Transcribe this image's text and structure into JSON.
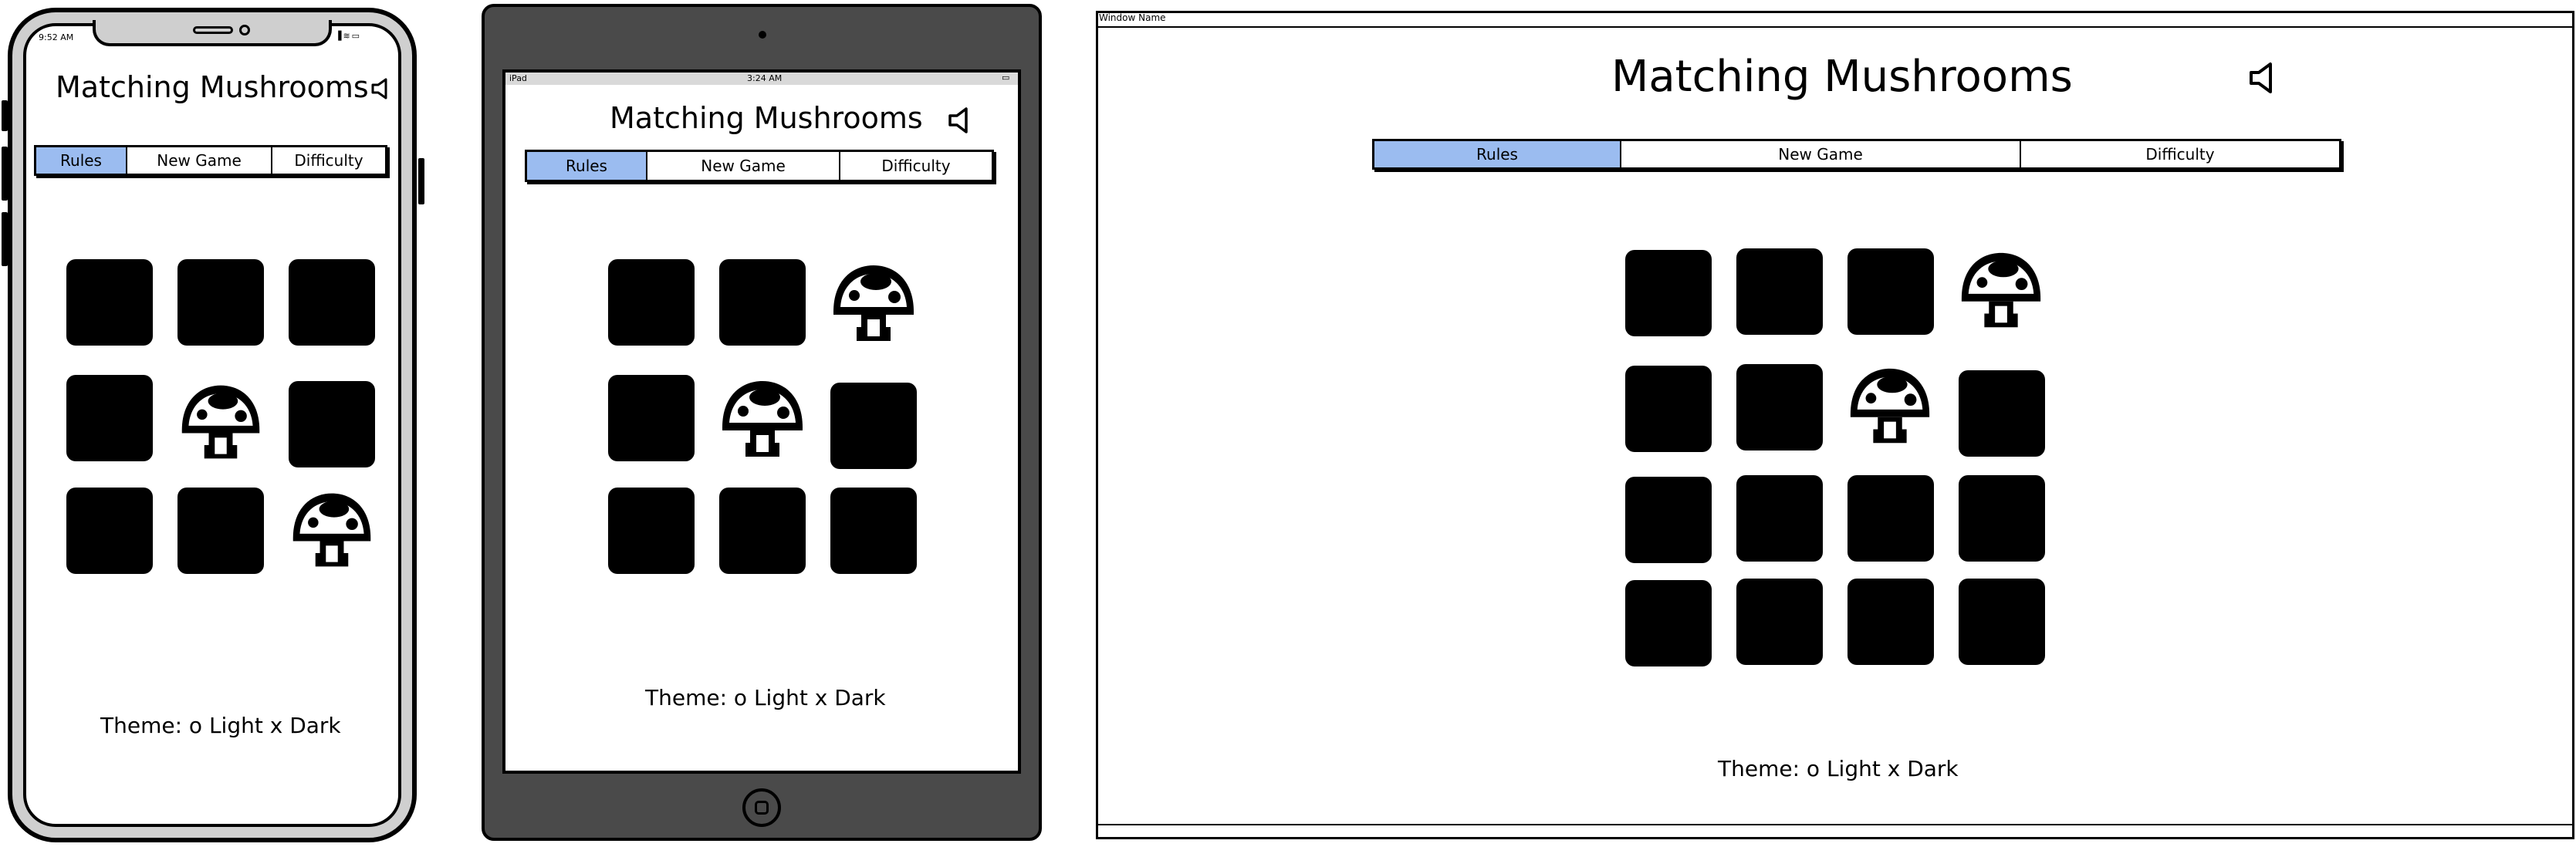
{
  "app_title": "Matching Mushrooms",
  "tabs": {
    "rules": "Rules",
    "new_game": "New Game",
    "difficulty": "Difficulty"
  },
  "theme_text": "Theme: o Light x Dark",
  "phone": {
    "status_time": "9:52 AM"
  },
  "tablet": {
    "status_device": "iPad",
    "status_time": "3:24 AM"
  },
  "desktop": {
    "window_name": "Window Name"
  },
  "colors": {
    "active_tab": "#9bbcf0",
    "tile": "#000000",
    "tablet_bezel": "#4a4a4a",
    "phone_bezel": "#cfcfcf"
  },
  "icons": {
    "sound": "speaker-icon",
    "card_face": "mushroom-icon"
  }
}
